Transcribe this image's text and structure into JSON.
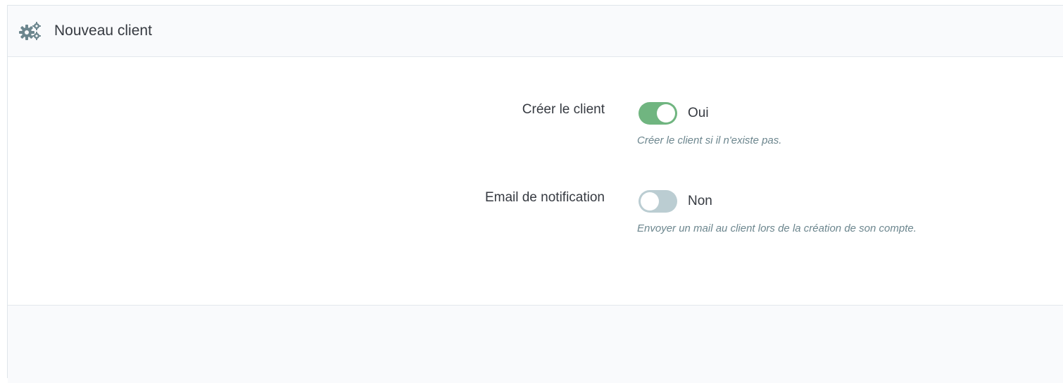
{
  "panel": {
    "title": "Nouveau client",
    "icon": "cogs-icon"
  },
  "fields": {
    "create_client": {
      "label": "Créer le client",
      "state": "on",
      "state_text": "Oui",
      "help": "Créer le client si il n'existe pas."
    },
    "notification_email": {
      "label": "Email de notification",
      "state": "off",
      "state_text": "Non",
      "help": "Envoyer un mail au client lors de la création de son compte."
    }
  },
  "colors": {
    "toggle_on": "#70b580",
    "toggle_off": "#bbcdd2",
    "help_text": "#6c868e",
    "text": "#363a41"
  }
}
